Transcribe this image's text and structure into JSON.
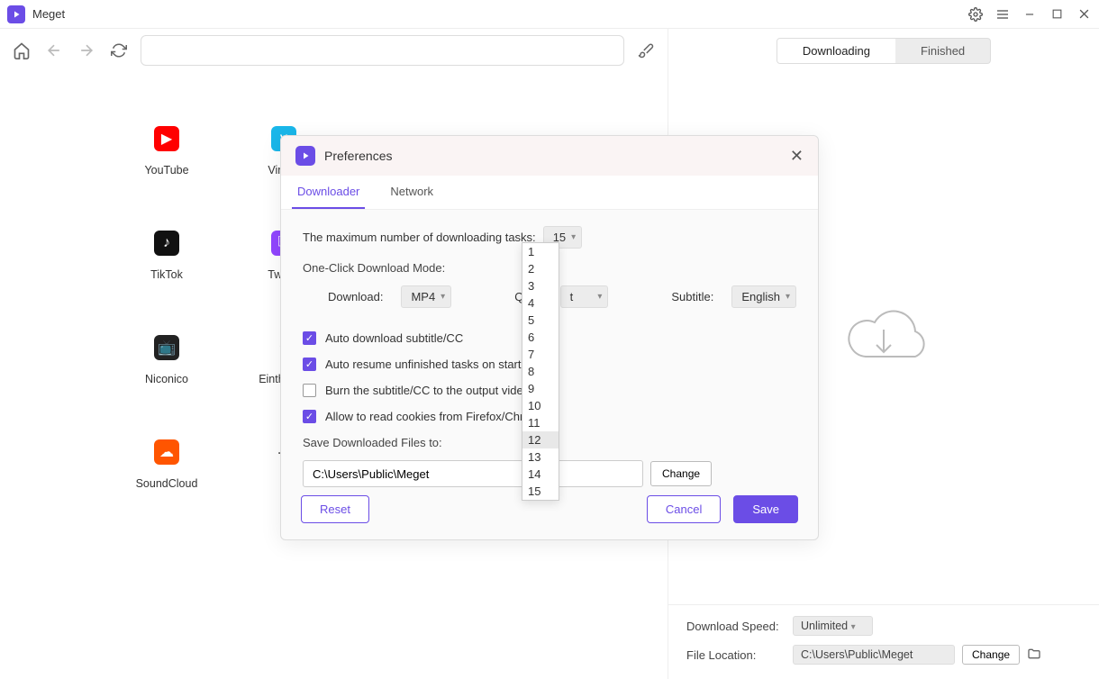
{
  "app": {
    "title": "Meget"
  },
  "toolbar": {
    "url": ""
  },
  "sites": [
    {
      "name": "YouTube",
      "bg": "#ff0000",
      "glyph": "▶"
    },
    {
      "name": "Vimeo",
      "bg": "#1ab7ea",
      "glyph": "v"
    },
    {
      "name": "TikTok",
      "bg": "#111",
      "glyph": "♪"
    },
    {
      "name": "Twitch",
      "bg": "#9146ff",
      "glyph": "⎘"
    },
    {
      "name": "Niconico",
      "bg": "#222",
      "glyph": "📺"
    },
    {
      "name": "Einthusan",
      "bg": "#fff",
      "glyph": "𝔈"
    },
    {
      "name": "SoundCloud",
      "bg": "#ff5500",
      "glyph": "☁"
    },
    {
      "name": "",
      "bg": "transparent",
      "glyph": "＋"
    }
  ],
  "tabs": {
    "downloading": "Downloading",
    "finished": "Finished"
  },
  "footer": {
    "speed_label": "Download Speed:",
    "speed_value": "Unlimited",
    "loc_label": "File Location:",
    "loc_value": "C:\\Users\\Public\\Meget",
    "change": "Change"
  },
  "modal": {
    "title": "Preferences",
    "tab_downloader": "Downloader",
    "tab_network": "Network",
    "max_tasks_label": "The maximum number of downloading tasks:",
    "max_tasks_value": "15",
    "oneclick_label": "One-Click Download Mode:",
    "dl_label": "Download:",
    "dl_value": "MP4",
    "quality_label": "Quali",
    "quality_value": "t",
    "sub_label": "Subtitle:",
    "sub_value": "English",
    "cb1": "Auto download subtitle/CC",
    "cb2": "Auto resume unfinished tasks on startup",
    "cb3": "Burn the subtitle/CC to the output video",
    "cb4": "Allow to read cookies from Firefox/Chrome",
    "save_label": "Save Downloaded Files to:",
    "save_path": "C:\\Users\\Public\\Meget",
    "change": "Change",
    "reset": "Reset",
    "cancel": "Cancel",
    "save": "Save"
  },
  "dropdown": {
    "items": [
      "1",
      "2",
      "3",
      "4",
      "5",
      "6",
      "7",
      "8",
      "9",
      "10",
      "11",
      "12",
      "13",
      "14",
      "15"
    ],
    "hover_index": 11
  }
}
